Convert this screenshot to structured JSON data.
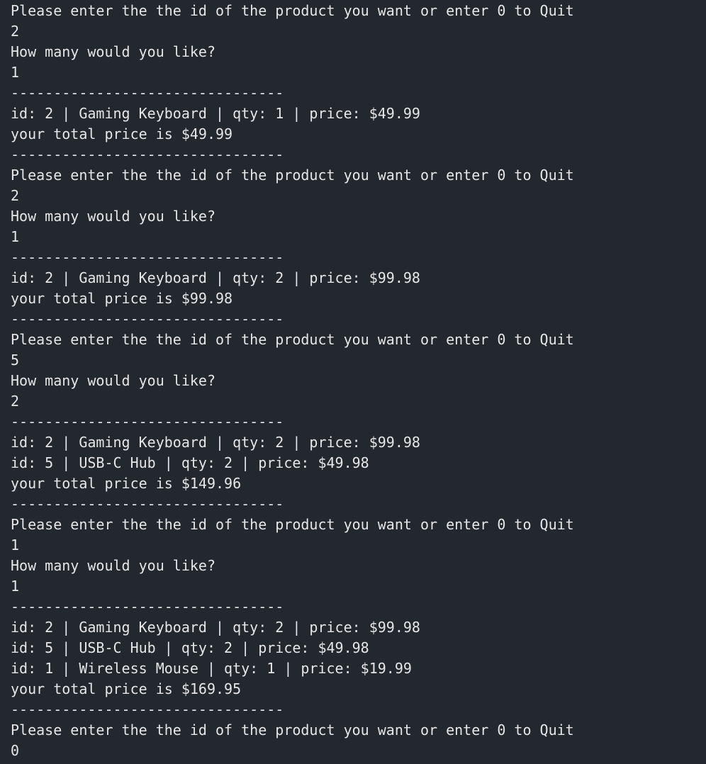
{
  "terminal": {
    "lines": [
      "Please enter the the id of the product you want or enter 0 to Quit",
      "2",
      "How many would you like?",
      "1",
      "--------------------------------",
      "id: 2 | Gaming Keyboard | qty: 1 | price: $49.99",
      "your total price is $49.99",
      "--------------------------------",
      "Please enter the the id of the product you want or enter 0 to Quit",
      "2",
      "How many would you like?",
      "1",
      "--------------------------------",
      "id: 2 | Gaming Keyboard | qty: 2 | price: $99.98",
      "your total price is $99.98",
      "--------------------------------",
      "Please enter the the id of the product you want or enter 0 to Quit",
      "5",
      "How many would you like?",
      "2",
      "--------------------------------",
      "id: 2 | Gaming Keyboard | qty: 2 | price: $99.98",
      "id: 5 | USB-C Hub | qty: 2 | price: $49.98",
      "your total price is $149.96",
      "--------------------------------",
      "Please enter the the id of the product you want or enter 0 to Quit",
      "1",
      "How many would you like?",
      "1",
      "--------------------------------",
      "id: 2 | Gaming Keyboard | qty: 2 | price: $99.98",
      "id: 5 | USB-C Hub | qty: 2 | price: $49.98",
      "id: 1 | Wireless Mouse | qty: 1 | price: $19.99",
      "your total price is $169.95",
      "--------------------------------",
      "Please enter the the id of the product you want or enter 0 to Quit",
      "0"
    ]
  }
}
